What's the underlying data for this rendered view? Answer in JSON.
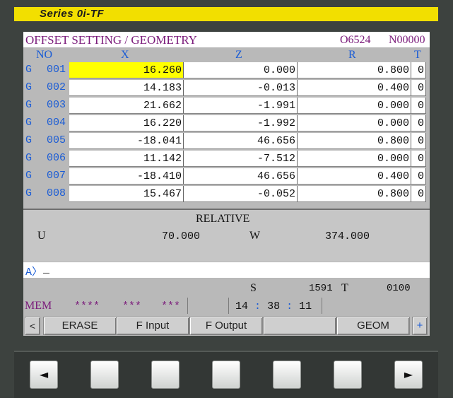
{
  "series_label": "Series 0i-TF",
  "header": {
    "title": "OFFSET SETTING / GEOMETRY",
    "program": "O6524",
    "sequence": "N00000"
  },
  "columns": {
    "no": "NO",
    "x": "X",
    "z": "Z",
    "r": "R",
    "t": "T"
  },
  "rows": [
    {
      "type": "G",
      "no": "001",
      "x": "16.260",
      "z": "0.000",
      "r": "0.800",
      "t": "0"
    },
    {
      "type": "G",
      "no": "002",
      "x": "14.183",
      "z": "-0.013",
      "r": "0.400",
      "t": "0"
    },
    {
      "type": "G",
      "no": "003",
      "x": "21.662",
      "z": "-1.991",
      "r": "0.000",
      "t": "0"
    },
    {
      "type": "G",
      "no": "004",
      "x": "16.220",
      "z": "-1.992",
      "r": "0.000",
      "t": "0"
    },
    {
      "type": "G",
      "no": "005",
      "x": "-18.041",
      "z": "46.656",
      "r": "0.800",
      "t": "0"
    },
    {
      "type": "G",
      "no": "006",
      "x": "11.142",
      "z": "-7.512",
      "r": "0.000",
      "t": "0"
    },
    {
      "type": "G",
      "no": "007",
      "x": "-18.410",
      "z": "46.656",
      "r": "0.400",
      "t": "0"
    },
    {
      "type": "G",
      "no": "008",
      "x": "15.467",
      "z": "-0.052",
      "r": "0.800",
      "t": "0"
    }
  ],
  "relative": {
    "title": "RELATIVE",
    "u_label": "U",
    "u_value": "70.000",
    "w_label": "W",
    "w_value": "374.000"
  },
  "input": {
    "prompt": "A",
    "bracket": "〉",
    "cursor": "_"
  },
  "status": {
    "s_label": "S",
    "s_value": "1591",
    "t_label": "T",
    "t_value": "0100",
    "mode": "MEM",
    "stars1": "****",
    "stars2": "***",
    "stars3": "***",
    "clock_h": "14",
    "clock_m": "38",
    "clock_s": "11",
    "clock_sep": ":"
  },
  "softkeys": {
    "left_arrow": "<",
    "erase": "ERASE",
    "f_input": "F Input",
    "f_output": "F Output",
    "blank": "",
    "geom": "GEOM",
    "plus": "+"
  },
  "hardware": {
    "left_icon": "left-triangle-icon",
    "left_glyph": "◄",
    "right_icon": "right-triangle-icon",
    "right_glyph": "►"
  },
  "colors": {
    "series_bar": "#f2df00",
    "title_text": "#7a1a7a",
    "header_text": "#1a5cd6",
    "selected_cell": "#ffff00"
  }
}
